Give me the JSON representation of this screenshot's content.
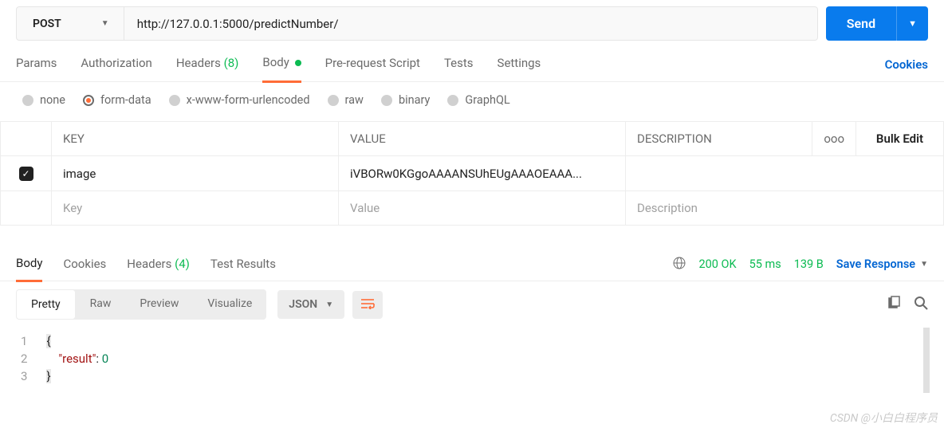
{
  "request": {
    "method": "POST",
    "url": "http://127.0.0.1:5000/predictNumber/",
    "send_label": "Send"
  },
  "tabs": {
    "params": "Params",
    "authorization": "Authorization",
    "headers": "Headers",
    "headers_count": "(8)",
    "body": "Body",
    "prerequest": "Pre-request Script",
    "tests": "Tests",
    "settings": "Settings",
    "cookies": "Cookies"
  },
  "body_types": {
    "none": "none",
    "form_data": "form-data",
    "urlencoded": "x-www-form-urlencoded",
    "raw": "raw",
    "binary": "binary",
    "graphql": "GraphQL"
  },
  "kv": {
    "header_key": "KEY",
    "header_value": "VALUE",
    "header_description": "DESCRIPTION",
    "bulk_edit": "Bulk Edit",
    "rows": [
      {
        "checked": true,
        "key": "image",
        "value": "iVBORw0KGgoAAAANSUhEUgAAAOEAAA..."
      }
    ],
    "placeholder_key": "Key",
    "placeholder_value": "Value",
    "placeholder_description": "Description",
    "more_icon": "ooo"
  },
  "response": {
    "tabs": {
      "body": "Body",
      "cookies": "Cookies",
      "headers": "Headers",
      "headers_count": "(4)",
      "test_results": "Test Results"
    },
    "status_code": "200 OK",
    "time": "55 ms",
    "size": "139 B",
    "save_response": "Save Response"
  },
  "viewer": {
    "pretty": "Pretty",
    "raw": "Raw",
    "preview": "Preview",
    "visualize": "Visualize",
    "lang": "JSON"
  },
  "json_body": {
    "line1": "{",
    "line2_key": "\"result\"",
    "line2_sep": ": ",
    "line2_val": "0",
    "line3": "}",
    "gutter": [
      "1",
      "2",
      "3"
    ]
  },
  "watermark": "CSDN @小白白程序员"
}
